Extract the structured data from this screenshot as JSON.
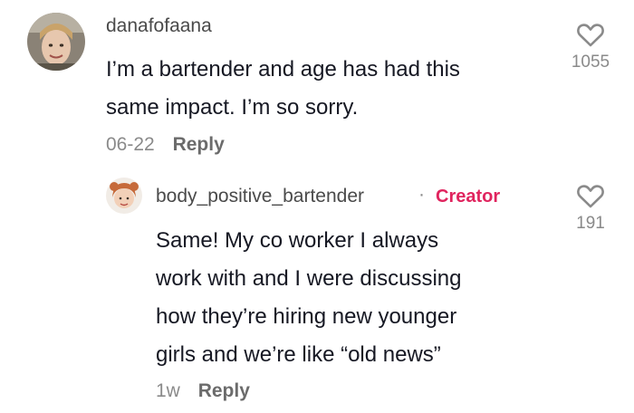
{
  "comment": {
    "username": "danafofaana",
    "text_line1": "I’m a bartender and age has had this",
    "text_line2": "same impact. I’m so sorry.",
    "date": "06-22",
    "reply_label": "Reply",
    "likes": "1055",
    "avatar_icon": "user-photo-avatar"
  },
  "reply": {
    "username": "body_positive_bartender",
    "separator": "·",
    "badge": "Creator",
    "text_line1": "Same! My co worker I always",
    "text_line2": "work with and I were discussing",
    "text_line3": "how they’re hiring new younger",
    "text_line4": "girls and we’re like “old news”",
    "date": "1w",
    "reply_label": "Reply",
    "likes": "191",
    "avatar_icon": "creator-photo-avatar"
  },
  "colors": {
    "text": "#161823",
    "secondary": "#8a8a8a",
    "creator_badge": "#e0245e"
  }
}
